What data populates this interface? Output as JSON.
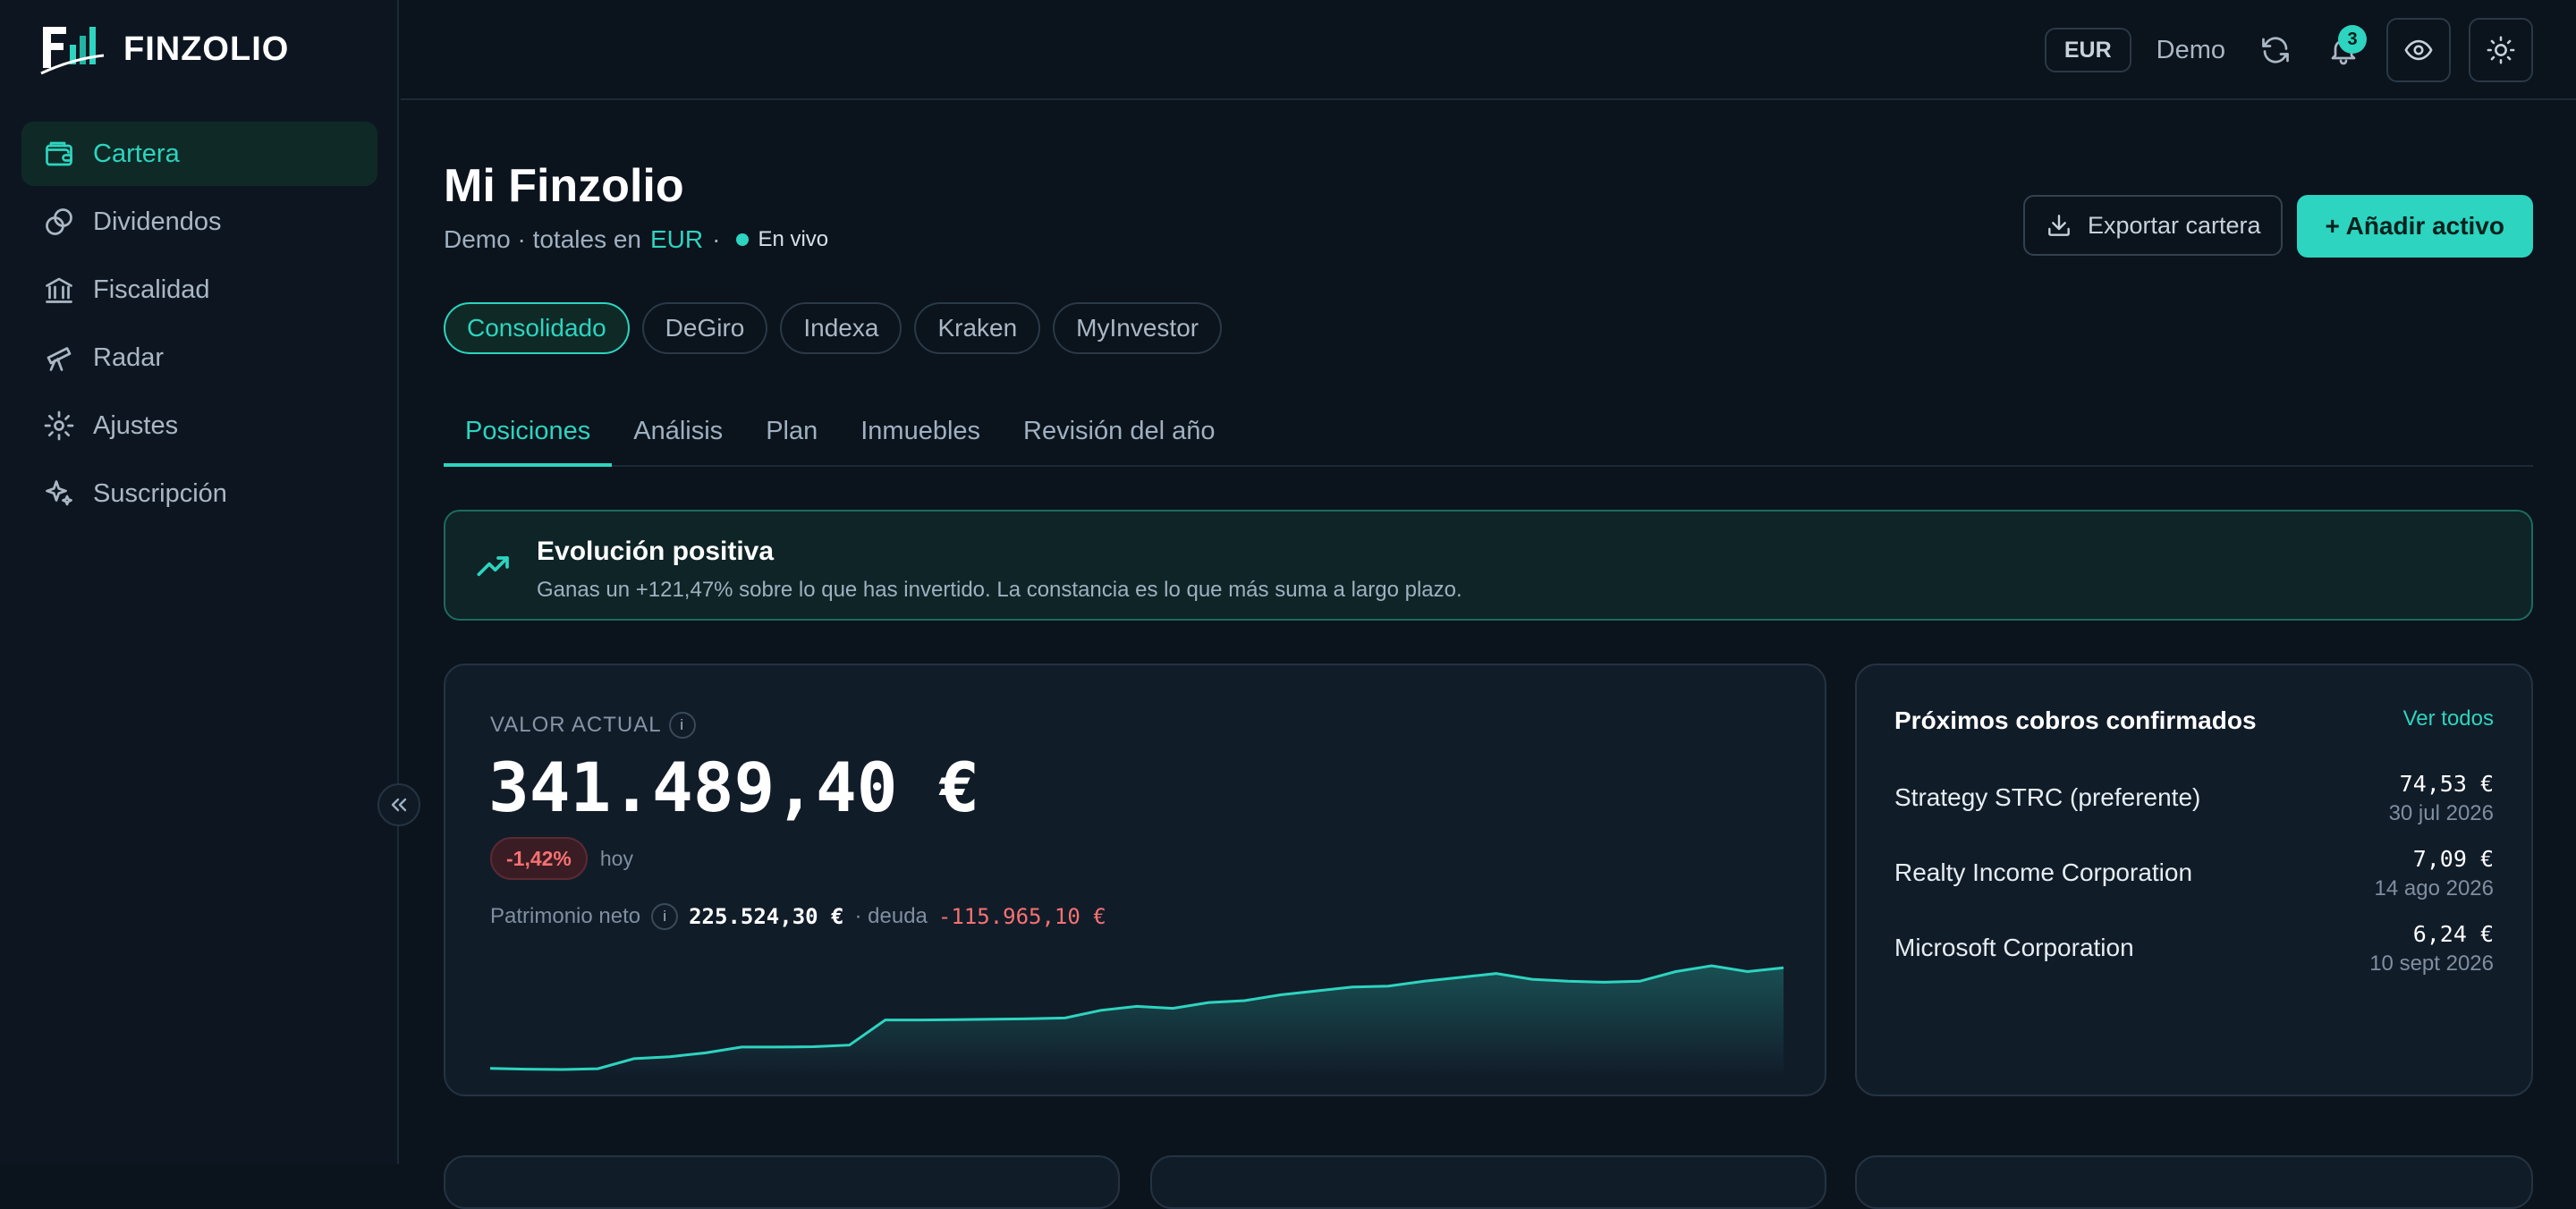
{
  "brand": {
    "name": "FINZOLIO"
  },
  "sidebar": {
    "items": [
      {
        "label": "Cartera",
        "icon": "wallet-icon",
        "active": true
      },
      {
        "label": "Dividendos",
        "icon": "coins-icon",
        "active": false
      },
      {
        "label": "Fiscalidad",
        "icon": "bank-icon",
        "active": false
      },
      {
        "label": "Radar",
        "icon": "telescope-icon",
        "active": false
      },
      {
        "label": "Ajustes",
        "icon": "gear-icon",
        "active": false
      },
      {
        "label": "Suscripción",
        "icon": "sparkles-icon",
        "active": false
      }
    ]
  },
  "topbar": {
    "currency": "EUR",
    "mode": "Demo",
    "notifications_count": "3"
  },
  "header": {
    "title": "Mi Finzolio",
    "subtitle_prefix": "Demo · totales en",
    "subtitle_currency": "EUR",
    "subtitle_sep": "·",
    "live_label": "En vivo",
    "export_label": "Exportar cartera",
    "add_label": "+ Añadir activo"
  },
  "brokers": [
    {
      "label": "Consolidado",
      "active": true
    },
    {
      "label": "DeGiro",
      "active": false
    },
    {
      "label": "Indexa",
      "active": false
    },
    {
      "label": "Kraken",
      "active": false
    },
    {
      "label": "MyInvestor",
      "active": false
    }
  ],
  "tabs": [
    {
      "label": "Posiciones",
      "active": true
    },
    {
      "label": "Análisis",
      "active": false
    },
    {
      "label": "Plan",
      "active": false
    },
    {
      "label": "Inmuebles",
      "active": false
    },
    {
      "label": "Revisión del año",
      "active": false
    }
  ],
  "banner": {
    "title": "Evolución positiva",
    "text": "Ganas un +121,47% sobre lo que has invertido. La constancia es lo que más suma a largo plazo."
  },
  "value_card": {
    "label": "VALOR ACTUAL",
    "value": "341.489,40 €",
    "change": "-1,42%",
    "change_period": "hoy",
    "net_label": "Patrimonio neto",
    "net_value": "225.524,30 €",
    "debt_label": "· deuda",
    "debt_value": "-115.965,10 €",
    "sparkline": [
      2,
      1.6,
      1.4,
      1.8,
      7,
      8,
      10,
      13,
      13,
      13.2,
      14,
      27,
      27,
      27.2,
      27.4,
      27.6,
      28,
      32,
      34,
      33,
      36,
      37,
      40,
      42,
      44,
      44.5,
      47,
      49,
      51,
      48,
      47,
      46.5,
      47,
      52,
      55,
      52,
      54
    ]
  },
  "cobros": {
    "title": "Próximos cobros confirmados",
    "link": "Ver todos",
    "items": [
      {
        "name": "Strategy STRC (preferente)",
        "amount": "74,53 €",
        "date": "30 jul 2026"
      },
      {
        "name": "Realty Income Corporation",
        "amount": "7,09 €",
        "date": "14 ago 2026"
      },
      {
        "name": "Microsoft Corporation",
        "amount": "6,24 €",
        "date": "10 sept 2026"
      }
    ]
  },
  "colors": {
    "accent": "#2dd4bf",
    "negative": "#f87171",
    "background": "#0b131d"
  }
}
